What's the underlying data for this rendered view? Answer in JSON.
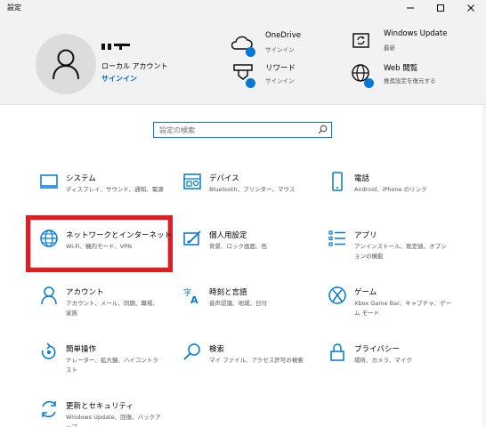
{
  "window": {
    "title": "設定"
  },
  "account": {
    "name_blocks": "■■■",
    "type": "ローカル アカウント",
    "signin": "サインイン"
  },
  "header_items": [
    {
      "icon": "onedrive-icon",
      "title": "OneDrive",
      "subtitle": "サインイン"
    },
    {
      "icon": "windows-update-icon",
      "title": "Windows Update",
      "subtitle": "最新"
    },
    {
      "icon": "rewards-icon",
      "title": "リワード",
      "subtitle": "サインイン"
    },
    {
      "icon": "web-browsing-icon",
      "title": "Web 閲覧",
      "subtitle": "推奨設定を復元する"
    }
  ],
  "search": {
    "placeholder": "設定の検索"
  },
  "categories": [
    {
      "icon": "system-icon",
      "title": "システム",
      "subtitle": "ディスプレイ、サウンド、通知、電源"
    },
    {
      "icon": "devices-icon",
      "title": "デバイス",
      "subtitle": "Bluetooth、プリンター、マウス"
    },
    {
      "icon": "phone-icon",
      "title": "電話",
      "subtitle": "Android、iPhone のリンク"
    },
    {
      "icon": "network-icon",
      "title": "ネットワークとインターネット",
      "subtitle": "Wi-Fi、機内モード、VPN"
    },
    {
      "icon": "personalization-icon",
      "title": "個人用設定",
      "subtitle": "背景、ロック画面、色"
    },
    {
      "icon": "apps-icon",
      "title": "アプリ",
      "subtitle": "アンインストール、既定値、オプションの機能"
    },
    {
      "icon": "accounts-icon",
      "title": "アカウント",
      "subtitle": "アカウント、メール、同期、職場、家族"
    },
    {
      "icon": "time-language-icon",
      "title": "時刻と言語",
      "subtitle": "音声認識、地域、日付"
    },
    {
      "icon": "gaming-icon",
      "title": "ゲーム",
      "subtitle": "Xbox Game Bar、キャプチャ、ゲーム モード"
    },
    {
      "icon": "ease-of-access-icon",
      "title": "簡単操作",
      "subtitle": "ナレーター、拡大鏡、ハイコントラスト"
    },
    {
      "icon": "search-category-icon",
      "title": "検索",
      "subtitle": "マイ ファイル、アクセス許可の検索"
    },
    {
      "icon": "privacy-icon",
      "title": "プライバシー",
      "subtitle": "場所、カメラ、マイク"
    },
    {
      "icon": "update-security-icon",
      "title": "更新とセキュリティ",
      "subtitle": "Windows Update、回復、バックアップ"
    }
  ],
  "colors": {
    "accent": "#0078d7",
    "highlight": "#e31c23",
    "header_bg": "#f2f2f2"
  }
}
